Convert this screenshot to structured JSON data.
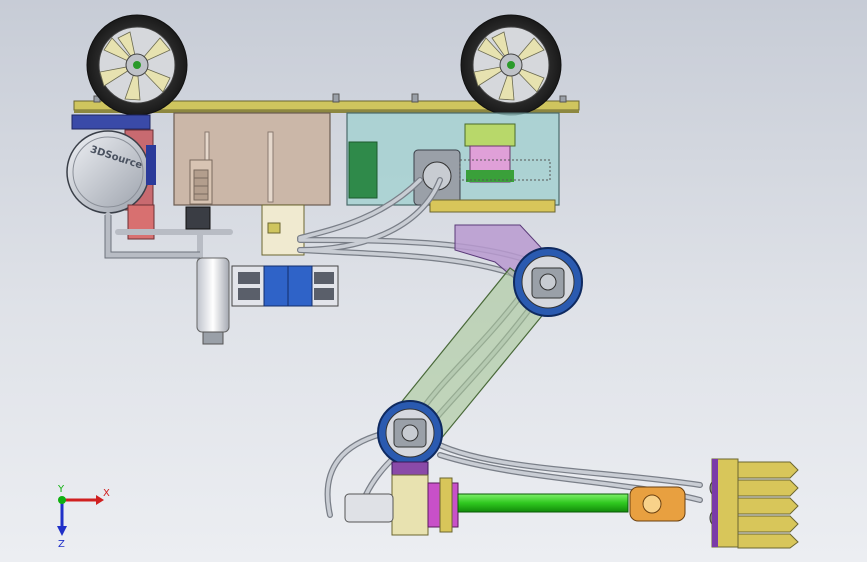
{
  "viewport": {
    "background_top": "#c7ccd6",
    "background_bottom": "#eceef2"
  },
  "model": {
    "motor_logo_text": "3DSource",
    "colors": {
      "frame_plate": "#c8c05a",
      "tank": "#c9b7a6",
      "cover_glass": "#9fd0cf",
      "arm_glass": "#a8c89a",
      "arm_purple": "#b89ad0",
      "joint_blue": "#2a5ab0",
      "hose": "#b8bcc4",
      "tool_shaft": "#2fc81f",
      "bucket": "#d8c65a",
      "wheel_tire": "#2a2a2a",
      "valve_blue": "#2f63c8",
      "pump_red": "#d06060",
      "filter_white": "#e8e8ee"
    }
  },
  "triad": {
    "x_label": "X",
    "y_label": "Y",
    "z_label": "Z",
    "x_color": "#d02020",
    "y_color": "#10b010",
    "z_color": "#2030c8"
  }
}
